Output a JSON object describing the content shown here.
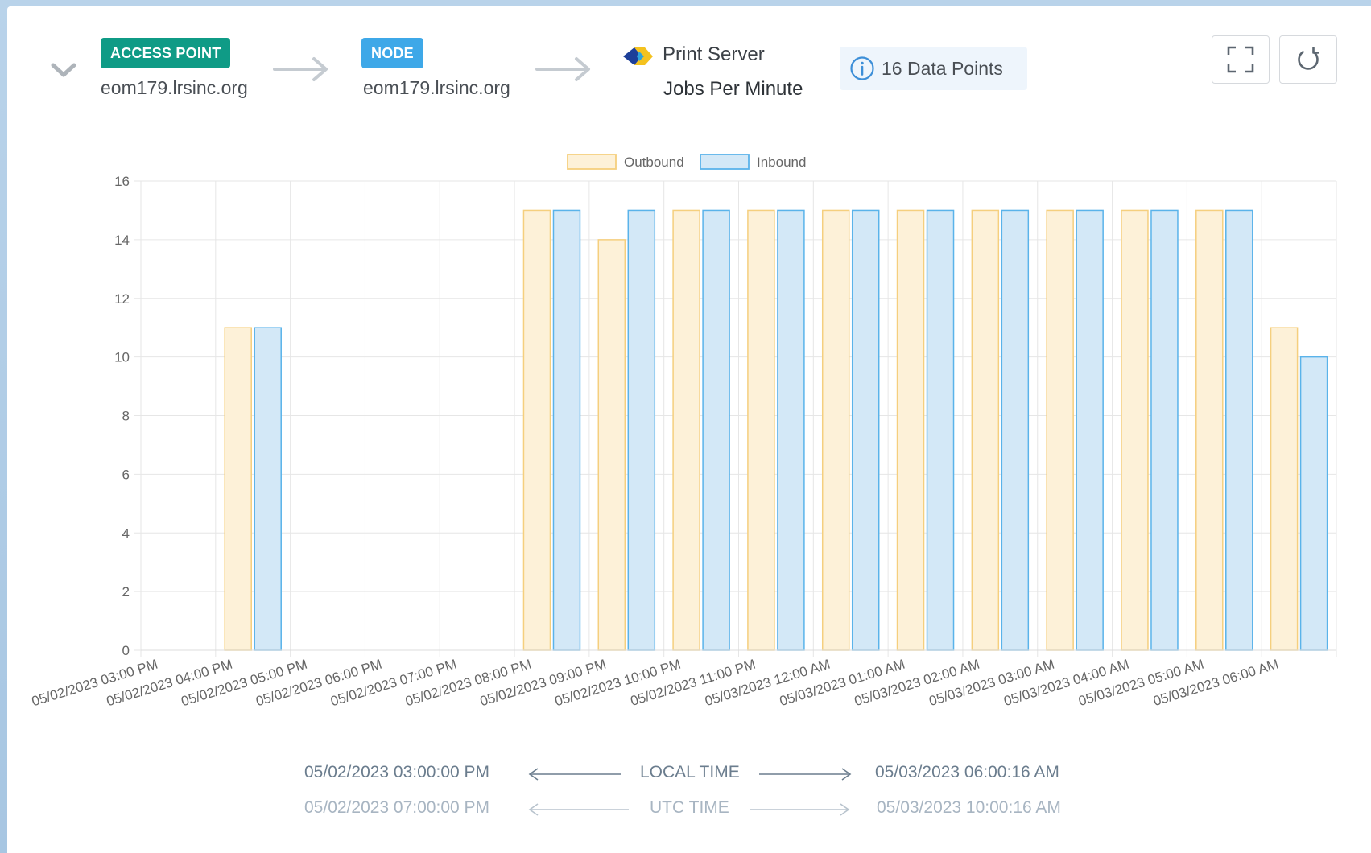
{
  "breadcrumb": {
    "access_point_badge": "ACCESS POINT",
    "access_point_host": "eom179.lrsinc.org",
    "node_badge": "NODE",
    "node_host": "eom179.lrsinc.org",
    "service_name": "Print Server",
    "metric_name": "Jobs Per Minute"
  },
  "data_points_label": "16 Data Points",
  "icons": {
    "collapse": "chevron-down-icon",
    "arrow": "arrow-right-icon",
    "service": "print-server-logo",
    "info": "info-icon",
    "fullscreen": "fullscreen-icon",
    "refresh": "refresh-icon"
  },
  "colors": {
    "access_point_badge": "#0f9b86",
    "node_badge": "#3ea8e8",
    "outbound_fill": "#fdf1d8",
    "outbound_border": "#f5cf7e",
    "inbound_fill": "#d3e8f7",
    "inbound_border": "#5ab3ea"
  },
  "chart_data": {
    "type": "bar",
    "legend_position": "top-center",
    "grid": true,
    "ylim": [
      0,
      16
    ],
    "yticks": [
      "0",
      "2",
      "4",
      "6",
      "8",
      "10",
      "12",
      "14",
      "16"
    ],
    "categories": [
      "05/02/2023 03:00 PM",
      "05/02/2023 04:00 PM",
      "05/02/2023 05:00 PM",
      "05/02/2023 06:00 PM",
      "05/02/2023 07:00 PM",
      "05/02/2023 08:00 PM",
      "05/02/2023 09:00 PM",
      "05/02/2023 10:00 PM",
      "05/02/2023 11:00 PM",
      "05/03/2023 12:00 AM",
      "05/03/2023 01:00 AM",
      "05/03/2023 02:00 AM",
      "05/03/2023 03:00 AM",
      "05/03/2023 04:00 AM",
      "05/03/2023 05:00 AM",
      "05/03/2023 06:00 AM"
    ],
    "series": [
      {
        "name": "Outbound",
        "values": [
          null,
          11,
          null,
          null,
          null,
          15,
          14,
          15,
          15,
          15,
          15,
          15,
          15,
          15,
          15,
          11
        ]
      },
      {
        "name": "Inbound",
        "values": [
          null,
          11,
          null,
          null,
          null,
          15,
          15,
          15,
          15,
          15,
          15,
          15,
          15,
          15,
          15,
          10
        ]
      }
    ]
  },
  "time_range": {
    "local_start": "05/02/2023 03:00:00 PM",
    "local_label": "LOCAL TIME",
    "local_end": "05/03/2023 06:00:16 AM",
    "utc_start": "05/02/2023 07:00:00 PM",
    "utc_label": "UTC TIME",
    "utc_end": "05/03/2023 10:00:16 AM"
  }
}
